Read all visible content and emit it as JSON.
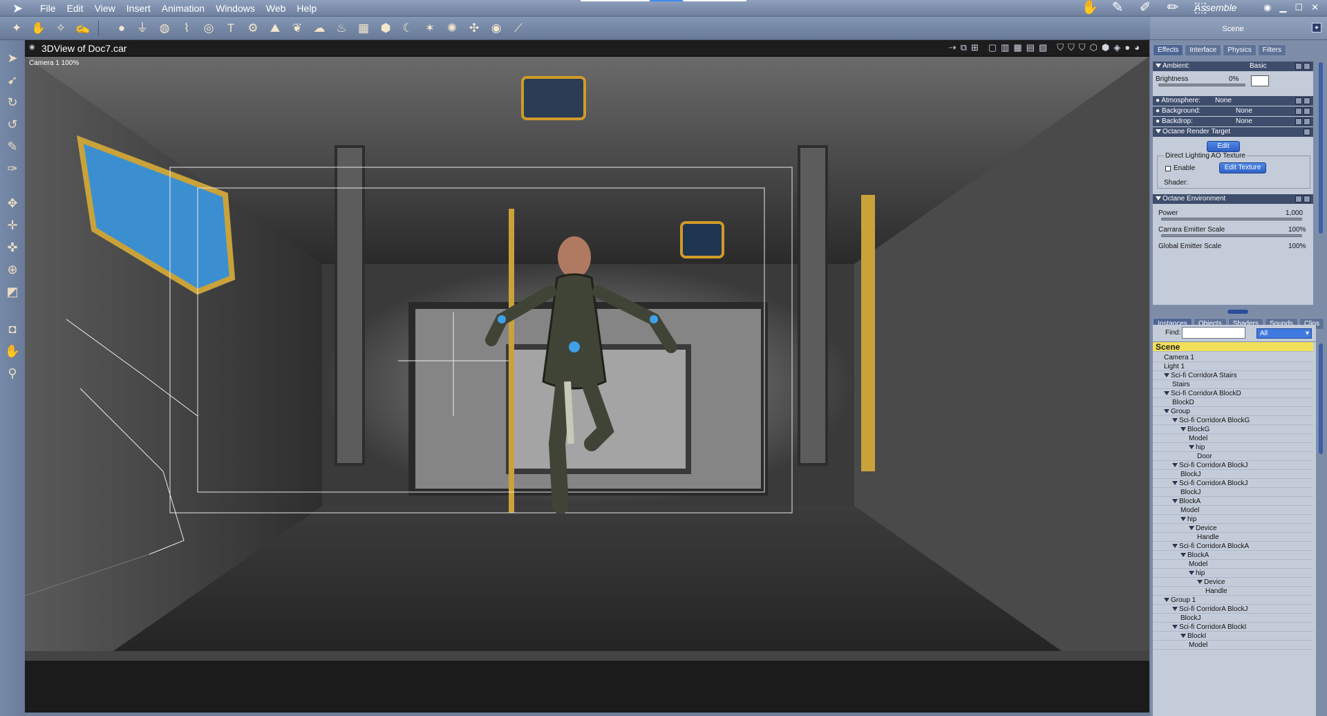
{
  "menubar": {
    "items": [
      "File",
      "Edit",
      "View",
      "Insert",
      "Animation",
      "Windows",
      "Web",
      "Help"
    ],
    "room_label": "Assemble"
  },
  "viewport": {
    "title": "3DView of Doc7.car",
    "camera_label": "Camera 1 100%"
  },
  "scene_panel": {
    "header": "Scene",
    "top_tabs": [
      "Effects",
      "Interface",
      "Physics",
      "Filters"
    ],
    "ambient": {
      "label": "Ambient:",
      "value": "Basic"
    },
    "brightness": {
      "label": "Brightness",
      "value": "0%"
    },
    "atmosphere": {
      "label": "Atmosphere:",
      "value": "None"
    },
    "background": {
      "label": "Background:",
      "value": "None"
    },
    "backdrop": {
      "label": "Backdrop:",
      "value": "None"
    },
    "render_target": {
      "label": "Octane Render Target",
      "edit": "Edit"
    },
    "ao": {
      "title": "Direct Lighting AO Texture",
      "enable": "Enable",
      "edit_texture": "Edit Texture",
      "shader": "Shader:"
    },
    "environment": {
      "label": "Octane Environment",
      "power_label": "Power",
      "power_value": "1,000",
      "carrara_label": "Carrara Emitter Scale",
      "carrara_value": "100%",
      "global_label": "Global Emitter Scale",
      "global_value": "100%"
    },
    "bottom_tabs": [
      "Instances",
      "Objects",
      "Shaders",
      "Sounds",
      "Clips"
    ],
    "find_label": "Find:",
    "find_value": "",
    "filter_value": "All",
    "tree": [
      {
        "label": "Scene",
        "depth": 0,
        "open": false
      },
      {
        "label": "Camera 1",
        "depth": 1,
        "open": false
      },
      {
        "label": "Light 1",
        "depth": 1,
        "open": false
      },
      {
        "label": "Sci-fi CorridorA Stairs",
        "depth": 1,
        "open": true
      },
      {
        "label": "Stairs",
        "depth": 2,
        "open": false
      },
      {
        "label": "Sci-fi CorridorA BlockD",
        "depth": 1,
        "open": true
      },
      {
        "label": "BlockD",
        "depth": 2,
        "open": false
      },
      {
        "label": "Group",
        "depth": 1,
        "open": true
      },
      {
        "label": "Sci-fi CorridorA BlockG",
        "depth": 2,
        "open": true
      },
      {
        "label": "BlockG",
        "depth": 3,
        "open": true
      },
      {
        "label": "Model",
        "depth": 4,
        "open": false
      },
      {
        "label": "hip",
        "depth": 4,
        "open": true
      },
      {
        "label": "Door",
        "depth": 5,
        "open": false
      },
      {
        "label": "Sci-fi CorridorA BlockJ",
        "depth": 2,
        "open": true
      },
      {
        "label": "BlockJ",
        "depth": 3,
        "open": false
      },
      {
        "label": "Sci-fi CorridorA BlockJ",
        "depth": 2,
        "open": true
      },
      {
        "label": "BlockJ",
        "depth": 3,
        "open": false
      },
      {
        "label": "BlockA",
        "depth": 2,
        "open": true
      },
      {
        "label": "Model",
        "depth": 3,
        "open": false
      },
      {
        "label": "hip",
        "depth": 3,
        "open": true
      },
      {
        "label": "Device",
        "depth": 4,
        "open": true
      },
      {
        "label": "Handle",
        "depth": 5,
        "open": false
      },
      {
        "label": "Sci-fi CorridorA BlockA",
        "depth": 2,
        "open": true
      },
      {
        "label": "BlockA",
        "depth": 3,
        "open": true
      },
      {
        "label": "Model",
        "depth": 4,
        "open": false
      },
      {
        "label": "hip",
        "depth": 4,
        "open": true
      },
      {
        "label": "Device",
        "depth": 5,
        "open": true
      },
      {
        "label": "Handle",
        "depth": 6,
        "open": false
      },
      {
        "label": "Group 1",
        "depth": 1,
        "open": true
      },
      {
        "label": "Sci-fi CorridorA BlockJ",
        "depth": 2,
        "open": true
      },
      {
        "label": "BlockJ",
        "depth": 3,
        "open": false
      },
      {
        "label": "Sci-fi CorridorA BlockI",
        "depth": 2,
        "open": true
      },
      {
        "label": "BlockI",
        "depth": 3,
        "open": true
      },
      {
        "label": "Model",
        "depth": 4,
        "open": false
      }
    ]
  },
  "colors": {
    "accent": "#3f7ae0",
    "panel": "#c4ccd9",
    "selection": "#f2e05a"
  }
}
